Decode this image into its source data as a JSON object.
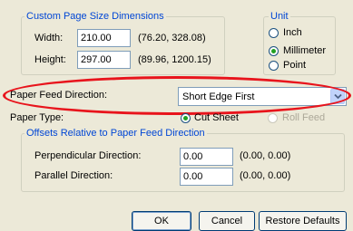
{
  "page_size": {
    "title": "Custom Page Size Dimensions",
    "width_label": "Width:",
    "width_value": "210.00",
    "width_range": "(76.20, 328.08)",
    "height_label": "Height:",
    "height_value": "297.00",
    "height_range": "(89.96, 1200.15)"
  },
  "unit": {
    "title": "Unit",
    "options": [
      {
        "label": "Inch",
        "selected": false
      },
      {
        "label": "Millimeter",
        "selected": true
      },
      {
        "label": "Point",
        "selected": false
      }
    ]
  },
  "paper_feed": {
    "label": "Paper Feed Direction:",
    "value": "Short Edge First"
  },
  "paper_type": {
    "label": "Paper Type:",
    "options": [
      {
        "label": "Cut Sheet",
        "selected": true,
        "enabled": true
      },
      {
        "label": "Roll Feed",
        "selected": false,
        "enabled": false
      }
    ]
  },
  "offsets": {
    "title": "Offsets Relative to Paper Feed Direction",
    "perpendicular_label": "Perpendicular Direction:",
    "perpendicular_value": "0.00",
    "perpendicular_range": "(0.00, 0.00)",
    "parallel_label": "Parallel Direction:",
    "parallel_value": "0.00",
    "parallel_range": "(0.00, 0.00)"
  },
  "buttons": {
    "ok": "OK",
    "cancel": "Cancel",
    "restore": "Restore Defaults"
  },
  "colors": {
    "annotation": "#e8141c",
    "group_title": "#0046d5",
    "radio_dot": "#21a121"
  }
}
